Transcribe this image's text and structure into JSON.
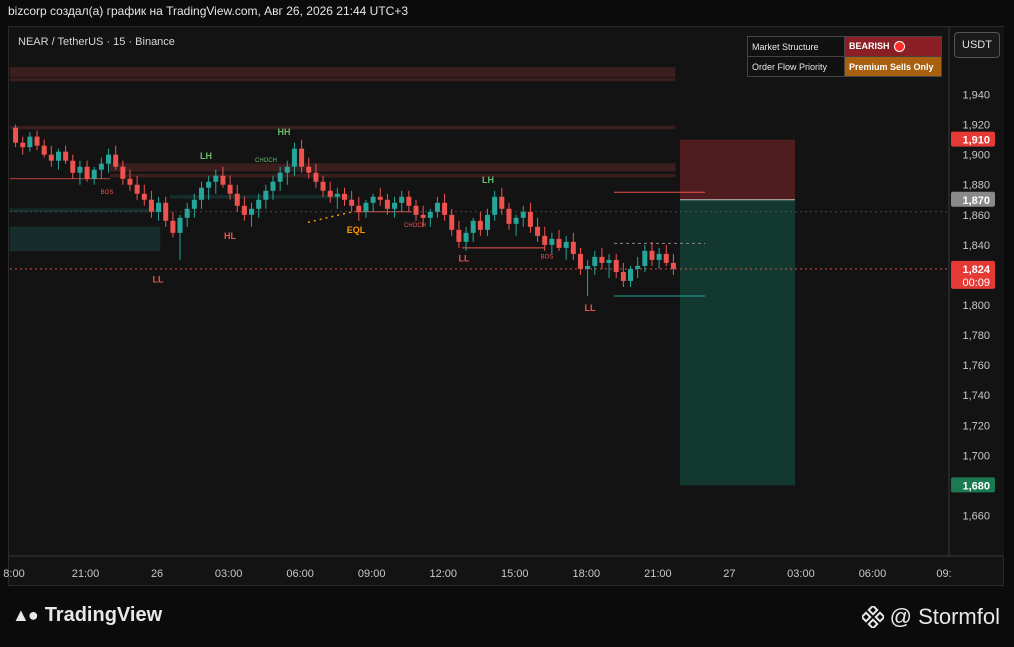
{
  "header": {
    "caption": "bizcorp создал(а) график на TradingView.com, Авг 26, 2026 21:44 UTC+3"
  },
  "symbol": {
    "label": "NEAR / TetherUS · 15 · Binance"
  },
  "currency_button": "USDT",
  "info_table": {
    "row1_label": "Market Structure",
    "row1_value": "BEARISH",
    "row2_label": "Order Flow Priority",
    "row2_value": "Premium Sells Only"
  },
  "footer": {
    "brand": "TradingView",
    "author": "@ Stormfol"
  },
  "colors": {
    "up": "#26a69a",
    "down": "#ef5350",
    "bg": "#131313"
  },
  "chart_data": {
    "type": "candlestick",
    "ylim": [
      1.645,
      1.955
    ],
    "y_ticks": [
      "1,940",
      "1,920",
      "1,900",
      "1,880",
      "1,860",
      "1,840",
      "1,820",
      "1,800",
      "1,780",
      "1,760",
      "1,740",
      "1,720",
      "1,700",
      "1,680",
      "1,660"
    ],
    "x_ticks": [
      "8:00",
      "21:00",
      "26",
      "03:00",
      "06:00",
      "09:00",
      "12:00",
      "15:00",
      "18:00",
      "21:00",
      "27",
      "03:00",
      "06:00",
      "09:"
    ],
    "price_labels": [
      {
        "text": "1,910",
        "value": 1.91,
        "color": "#e53935"
      },
      {
        "text": "1,870",
        "value": 1.87,
        "color": "#8a8a8a"
      },
      {
        "text": "1,824",
        "sub": "00:09",
        "value": 1.824,
        "color": "#e53935"
      },
      {
        "text": "1,680",
        "value": 1.68,
        "color": "#1b7a52"
      }
    ],
    "structure_labels": [
      {
        "text": "LL",
        "i": 0,
        "value": 1.815,
        "color": "#ef5350"
      },
      {
        "text": "LH",
        "i": 0,
        "value": 1.897,
        "color": "#66bb6a"
      },
      {
        "text": "HL",
        "i": 0,
        "value": 1.844,
        "color": "#ef5350"
      },
      {
        "text": "HH",
        "i": 0,
        "value": 1.913,
        "color": "#66bb6a"
      },
      {
        "text": "CHOCH",
        "i": 0,
        "value": 1.895,
        "color": "#66bb6a"
      },
      {
        "text": "EQL",
        "i": 0,
        "value": 1.848,
        "color": "#ff9800"
      },
      {
        "text": "CHOCH",
        "i": 0,
        "value": 1.852,
        "color": "#ef5350"
      },
      {
        "text": "LL",
        "i": 0,
        "value": 1.829,
        "color": "#ef5350"
      },
      {
        "text": "LH",
        "i": 0,
        "value": 1.881,
        "color": "#66bb6a"
      },
      {
        "text": "BOS",
        "i": 0,
        "value": 1.831,
        "color": "#ef5350"
      },
      {
        "text": "BOS",
        "i": 0,
        "value": 1.874,
        "color": "#ef5350"
      },
      {
        "text": "LL",
        "i": 0,
        "value": 1.796,
        "color": "#ef5350"
      }
    ],
    "trade": {
      "entry": 1.87,
      "stop": 1.91,
      "target": 1.68
    },
    "current_price": 1.824,
    "ohlc": [
      [
        1.918,
        1.92,
        1.905,
        1.908
      ],
      [
        1.908,
        1.912,
        1.9,
        1.905
      ],
      [
        1.905,
        1.915,
        1.902,
        1.912
      ],
      [
        1.912,
        1.916,
        1.903,
        1.906
      ],
      [
        1.906,
        1.91,
        1.898,
        1.9
      ],
      [
        1.9,
        1.906,
        1.892,
        1.896
      ],
      [
        1.896,
        1.904,
        1.89,
        1.902
      ],
      [
        1.902,
        1.906,
        1.894,
        1.896
      ],
      [
        1.896,
        1.9,
        1.884,
        1.888
      ],
      [
        1.888,
        1.896,
        1.88,
        1.892
      ],
      [
        1.892,
        1.896,
        1.882,
        1.884
      ],
      [
        1.884,
        1.892,
        1.88,
        1.89
      ],
      [
        1.89,
        1.898,
        1.884,
        1.894
      ],
      [
        1.894,
        1.904,
        1.888,
        1.9
      ],
      [
        1.9,
        1.906,
        1.89,
        1.892
      ],
      [
        1.892,
        1.896,
        1.88,
        1.884
      ],
      [
        1.884,
        1.89,
        1.876,
        1.88
      ],
      [
        1.88,
        1.886,
        1.87,
        1.874
      ],
      [
        1.874,
        1.88,
        1.866,
        1.87
      ],
      [
        1.87,
        1.876,
        1.858,
        1.862
      ],
      [
        1.862,
        1.872,
        1.856,
        1.868
      ],
      [
        1.868,
        1.872,
        1.852,
        1.856
      ],
      [
        1.856,
        1.862,
        1.845,
        1.848
      ],
      [
        1.848,
        1.86,
        1.83,
        1.858
      ],
      [
        1.858,
        1.868,
        1.852,
        1.864
      ],
      [
        1.864,
        1.874,
        1.858,
        1.87
      ],
      [
        1.87,
        1.882,
        1.864,
        1.878
      ],
      [
        1.878,
        1.886,
        1.87,
        1.882
      ],
      [
        1.882,
        1.89,
        1.874,
        1.886
      ],
      [
        1.886,
        1.892,
        1.878,
        1.88
      ],
      [
        1.88,
        1.886,
        1.87,
        1.874
      ],
      [
        1.874,
        1.88,
        1.862,
        1.866
      ],
      [
        1.866,
        1.872,
        1.856,
        1.86
      ],
      [
        1.86,
        1.868,
        1.852,
        1.864
      ],
      [
        1.864,
        1.874,
        1.858,
        1.87
      ],
      [
        1.87,
        1.88,
        1.864,
        1.876
      ],
      [
        1.876,
        1.886,
        1.87,
        1.882
      ],
      [
        1.882,
        1.892,
        1.876,
        1.888
      ],
      [
        1.888,
        1.896,
        1.88,
        1.892
      ],
      [
        1.892,
        1.908,
        1.886,
        1.904
      ],
      [
        1.904,
        1.91,
        1.888,
        1.892
      ],
      [
        1.892,
        1.898,
        1.884,
        1.888
      ],
      [
        1.888,
        1.894,
        1.878,
        1.882
      ],
      [
        1.882,
        1.886,
        1.872,
        1.876
      ],
      [
        1.876,
        1.882,
        1.868,
        1.872
      ],
      [
        1.872,
        1.878,
        1.864,
        1.874
      ],
      [
        1.874,
        1.878,
        1.866,
        1.87
      ],
      [
        1.87,
        1.876,
        1.862,
        1.866
      ],
      [
        1.866,
        1.872,
        1.856,
        1.862
      ],
      [
        1.862,
        1.87,
        1.858,
        1.868
      ],
      [
        1.868,
        1.874,
        1.862,
        1.872
      ],
      [
        1.872,
        1.878,
        1.866,
        1.87
      ],
      [
        1.87,
        1.874,
        1.86,
        1.864
      ],
      [
        1.864,
        1.872,
        1.858,
        1.868
      ],
      [
        1.868,
        1.876,
        1.862,
        1.872
      ],
      [
        1.872,
        1.876,
        1.862,
        1.866
      ],
      [
        1.866,
        1.87,
        1.856,
        1.86
      ],
      [
        1.86,
        1.866,
        1.852,
        1.858
      ],
      [
        1.858,
        1.864,
        1.852,
        1.862
      ],
      [
        1.862,
        1.872,
        1.858,
        1.868
      ],
      [
        1.868,
        1.874,
        1.856,
        1.86
      ],
      [
        1.86,
        1.864,
        1.846,
        1.85
      ],
      [
        1.85,
        1.856,
        1.838,
        1.842
      ],
      [
        1.842,
        1.852,
        1.836,
        1.848
      ],
      [
        1.848,
        1.858,
        1.842,
        1.856
      ],
      [
        1.856,
        1.862,
        1.846,
        1.85
      ],
      [
        1.85,
        1.864,
        1.846,
        1.86
      ],
      [
        1.86,
        1.876,
        1.856,
        1.872
      ],
      [
        1.872,
        1.878,
        1.86,
        1.864
      ],
      [
        1.864,
        1.868,
        1.85,
        1.854
      ],
      [
        1.854,
        1.86,
        1.846,
        1.858
      ],
      [
        1.858,
        1.866,
        1.852,
        1.862
      ],
      [
        1.862,
        1.868,
        1.848,
        1.852
      ],
      [
        1.852,
        1.858,
        1.842,
        1.846
      ],
      [
        1.846,
        1.852,
        1.836,
        1.84
      ],
      [
        1.84,
        1.848,
        1.834,
        1.844
      ],
      [
        1.844,
        1.85,
        1.836,
        1.838
      ],
      [
        1.838,
        1.846,
        1.83,
        1.842
      ],
      [
        1.842,
        1.848,
        1.83,
        1.834
      ],
      [
        1.834,
        1.838,
        1.82,
        1.824
      ],
      [
        1.824,
        1.83,
        1.806,
        1.826
      ],
      [
        1.826,
        1.836,
        1.82,
        1.832
      ],
      [
        1.832,
        1.838,
        1.824,
        1.828
      ],
      [
        1.828,
        1.834,
        1.818,
        1.83
      ],
      [
        1.83,
        1.834,
        1.818,
        1.822
      ],
      [
        1.822,
        1.828,
        1.812,
        1.816
      ],
      [
        1.816,
        1.826,
        1.812,
        1.824
      ],
      [
        1.824,
        1.832,
        1.818,
        1.826
      ],
      [
        1.826,
        1.84,
        1.822,
        1.836
      ],
      [
        1.836,
        1.842,
        1.826,
        1.83
      ],
      [
        1.83,
        1.838,
        1.824,
        1.834
      ],
      [
        1.834,
        1.84,
        1.826,
        1.828
      ],
      [
        1.828,
        1.834,
        1.82,
        1.824
      ]
    ]
  }
}
